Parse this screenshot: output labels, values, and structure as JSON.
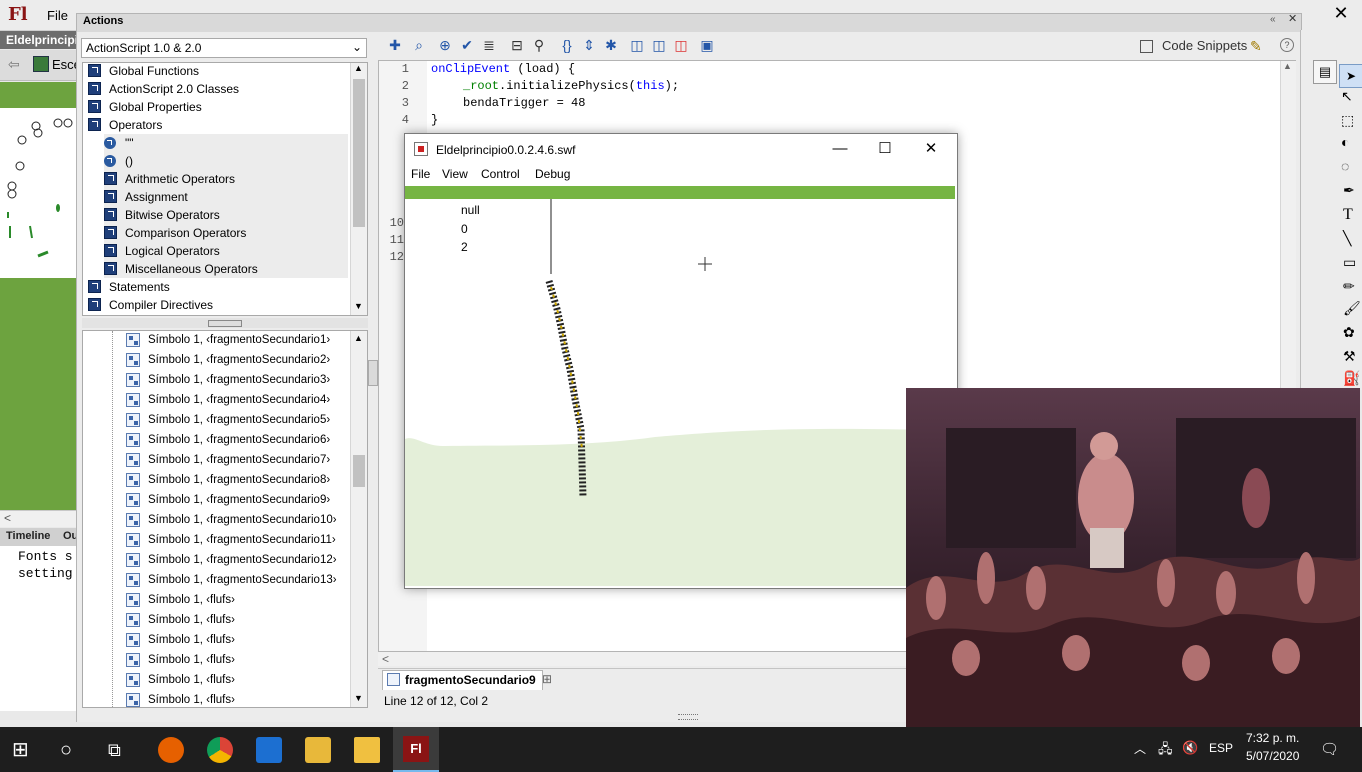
{
  "app": {
    "logo": "Fl",
    "file_menu": "File"
  },
  "document": {
    "tab": "Eldelprincipi",
    "scene": "Esce"
  },
  "panel": {
    "title": "Actions",
    "language": "ActionScript 1.0 & 2.0",
    "code_snippets": "Code Snippets"
  },
  "toolbox": {
    "items": [
      {
        "label": "Global Functions",
        "kind": "book"
      },
      {
        "label": "ActionScript 2.0 Classes",
        "kind": "book"
      },
      {
        "label": "Global Properties",
        "kind": "book"
      },
      {
        "label": "Operators",
        "kind": "open-book"
      },
      {
        "label": "\"\"",
        "kind": "item"
      },
      {
        "label": "()",
        "kind": "item"
      },
      {
        "label": "Arithmetic Operators",
        "kind": "subbook"
      },
      {
        "label": "Assignment",
        "kind": "subbook"
      },
      {
        "label": "Bitwise Operators",
        "kind": "subbook"
      },
      {
        "label": "Comparison Operators",
        "kind": "subbook"
      },
      {
        "label": "Logical Operators",
        "kind": "subbook"
      },
      {
        "label": "Miscellaneous Operators",
        "kind": "subbook"
      },
      {
        "label": "Statements",
        "kind": "book"
      },
      {
        "label": "Compiler Directives",
        "kind": "book"
      }
    ]
  },
  "tree": {
    "items": [
      "Símbolo 1, ‹fragmentoSecundario1›",
      "Símbolo 1, ‹fragmentoSecundario2›",
      "Símbolo 1, ‹fragmentoSecundario3›",
      "Símbolo 1, ‹fragmentoSecundario4›",
      "Símbolo 1, ‹fragmentoSecundario5›",
      "Símbolo 1, ‹fragmentoSecundario6›",
      "Símbolo 1, ‹fragmentoSecundario7›",
      "Símbolo 1, ‹fragmentoSecundario8›",
      "Símbolo 1, ‹fragmentoSecundario9›",
      "Símbolo 1, ‹fragmentoSecundario10›",
      "Símbolo 1, ‹fragmentoSecundario11›",
      "Símbolo 1, ‹fragmentoSecundario12›",
      "Símbolo 1, ‹fragmentoSecundario13›",
      "Símbolo 1, ‹flufs›",
      "Símbolo 1, ‹flufs›",
      "Símbolo 1, ‹flufs›",
      "Símbolo 1, ‹flufs›",
      "Símbolo 1, ‹flufs›",
      "Símbolo 1, ‹flufs›"
    ]
  },
  "editor": {
    "line_numbers": [
      "1",
      "2",
      "3",
      "4"
    ],
    "hidden_line_numbers": [
      "10",
      "11",
      "12"
    ],
    "lines": {
      "l1_kw": "onClipEvent",
      "l1_rest": " (load) {",
      "l2_root": "_root",
      "l2_mid": ".initializePhysics(",
      "l2_this": "this",
      "l2_end": ");",
      "l3": "bendaTrigger = 48",
      "l4": "}"
    },
    "script_tab": "fragmentoSecundario9",
    "status": "Line 12 of 12, Col 2"
  },
  "output": {
    "text": "Fonts s\nsetting"
  },
  "left_tabs": {
    "timeline": "Timeline",
    "output": "Ou"
  },
  "swf": {
    "title": "Eldelprincipio0.0.2.4.6.swf",
    "menu": [
      "File",
      "View",
      "Control",
      "Debug"
    ],
    "trace": [
      "null",
      "0",
      "2"
    ]
  },
  "taskbar": {
    "language": "ESP",
    "time": "7:32 p. m.",
    "date": "5/07/2020"
  },
  "colors": {
    "stage_green": "#76b543",
    "ground": "#e4efd9",
    "flash_red": "#8a1414"
  }
}
